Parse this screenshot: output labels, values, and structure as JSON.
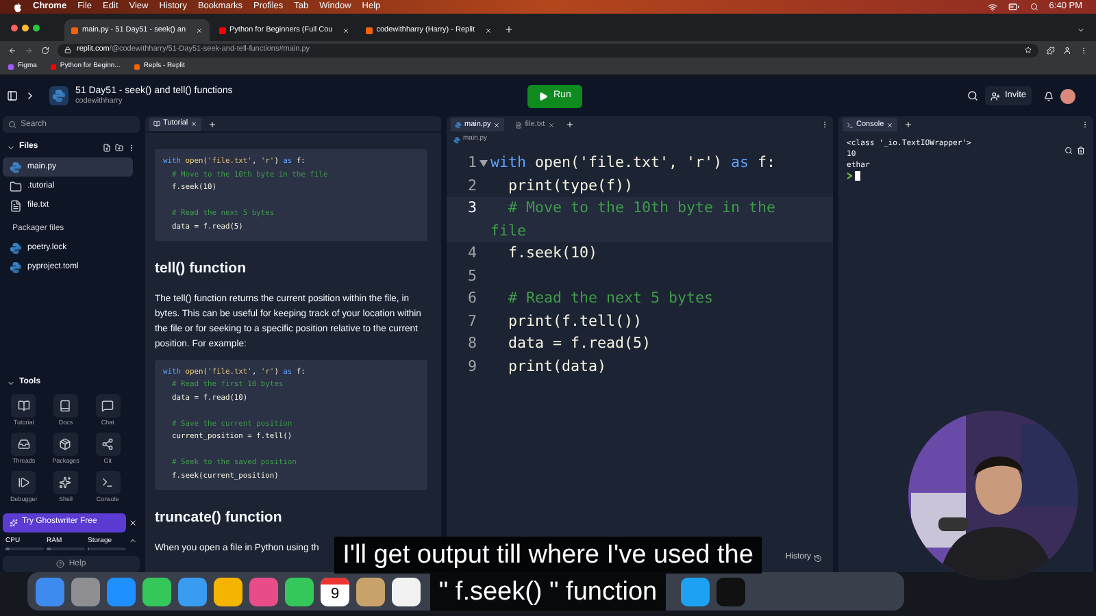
{
  "menu_bar": {
    "items": [
      "Chrome",
      "File",
      "Edit",
      "View",
      "History",
      "Bookmarks",
      "Profiles",
      "Tab",
      "Window",
      "Help"
    ],
    "clock": "6:40 PM"
  },
  "browser": {
    "tabs": [
      {
        "title": "main.py - 51 Day51 - seek() an",
        "selected": true
      },
      {
        "title": "Python for Beginners (Full Cou",
        "selected": false
      },
      {
        "title": "codewithharry (Harry) - Replit",
        "selected": false
      }
    ],
    "url_host": "replit.com",
    "url_path": "/@codewithharry/51-Day51-seek-and-tell-functions#main.py",
    "bookmarks": [
      "Figma",
      "Python for Beginn...",
      "Repls - Replit"
    ]
  },
  "header": {
    "title": "51 Day51 - seek() and tell() functions",
    "owner": "codewithharry",
    "run": "Run",
    "invite": "Invite"
  },
  "sidebar": {
    "search_placeholder": "Search",
    "files_heading": "Files",
    "files": [
      {
        "name": "main.py",
        "kind": "python",
        "selected": true
      },
      {
        "name": ".tutorial",
        "kind": "folder",
        "selected": false
      },
      {
        "name": "file.txt",
        "kind": "text",
        "selected": false
      }
    ],
    "packager_heading": "Packager files",
    "packager_files": [
      {
        "name": "poetry.lock",
        "kind": "python",
        "selected": false
      },
      {
        "name": "pyproject.toml",
        "kind": "python",
        "selected": false
      }
    ],
    "tools_heading": "Tools",
    "tools": [
      {
        "label": "Tutorial",
        "kind": "book"
      },
      {
        "label": "Docs",
        "kind": "docs"
      },
      {
        "label": "Chat",
        "kind": "chat"
      },
      {
        "label": "Threads",
        "kind": "inbox"
      },
      {
        "label": "Packages",
        "kind": "package"
      },
      {
        "label": "Git",
        "kind": "git"
      },
      {
        "label": "Debugger",
        "kind": "debug"
      },
      {
        "label": "Shell",
        "kind": "shell"
      },
      {
        "label": "Console",
        "kind": "console"
      }
    ],
    "ghostwriter": "Try Ghostwriter Free",
    "resources": [
      {
        "label": "CPU",
        "level": 0.1
      },
      {
        "label": "RAM",
        "level": 0.1
      },
      {
        "label": "Storage",
        "level": 0.05
      }
    ],
    "help": "Help"
  },
  "tutorial": {
    "tab": "Tutorial",
    "blocks": [
      {
        "kind": "code",
        "lines": [
          [
            {
              "kind": "kw",
              "text": "with"
            },
            {
              "kind": "fn",
              "text": " open("
            },
            {
              "kind": "str",
              "text": "'file.txt'"
            },
            {
              "kind": "plain",
              "text": ", "
            },
            {
              "kind": "str",
              "text": "'r'"
            },
            {
              "kind": "plain",
              "text": ") "
            },
            {
              "kind": "kw",
              "text": "as"
            },
            {
              "kind": "plain",
              "text": " f:"
            }
          ],
          [
            {
              "kind": "comment",
              "text": "  # Move to the 10th byte in the file"
            }
          ],
          [
            {
              "kind": "plain",
              "text": "  f.seek(10)"
            }
          ],
          [
            {
              "kind": "blank"
            }
          ],
          [
            {
              "kind": "comment",
              "text": "  # Read the next 5 bytes"
            }
          ],
          [
            {
              "kind": "plain",
              "text": "  data = f.read(5)"
            }
          ]
        ]
      },
      {
        "kind": "heading",
        "text": "tell() function"
      },
      {
        "kind": "paragraph",
        "text": "The tell() function returns the current position within the file, in bytes. This can be useful for keeping track of your location within the file or for seeking to a specific position relative to the current position. For example:"
      },
      {
        "kind": "code",
        "lines": [
          [
            {
              "kind": "kw",
              "text": "with"
            },
            {
              "kind": "fn",
              "text": " open("
            },
            {
              "kind": "str",
              "text": "'file.txt'"
            },
            {
              "kind": "plain",
              "text": ", "
            },
            {
              "kind": "str",
              "text": "'r'"
            },
            {
              "kind": "plain",
              "text": ") "
            },
            {
              "kind": "kw",
              "text": "as"
            },
            {
              "kind": "plain",
              "text": " f:"
            }
          ],
          [
            {
              "kind": "comment",
              "text": "  # Read the first 10 bytes"
            }
          ],
          [
            {
              "kind": "plain",
              "text": "  data = f.read(10)"
            }
          ],
          [
            {
              "kind": "blank"
            }
          ],
          [
            {
              "kind": "comment",
              "text": "  # Save the current position"
            }
          ],
          [
            {
              "kind": "plain",
              "text": "  current_position = f.tell()"
            }
          ],
          [
            {
              "kind": "blank"
            }
          ],
          [
            {
              "kind": "comment",
              "text": "  # Seek to the saved position"
            }
          ],
          [
            {
              "kind": "plain",
              "text": "  f.seek(current_position)"
            }
          ]
        ]
      },
      {
        "kind": "heading",
        "text": "truncate() function"
      },
      {
        "kind": "paragraph",
        "text": "When you open a file in Python using th"
      }
    ]
  },
  "editor": {
    "tabs": [
      {
        "label": "main.py",
        "kind": "python",
        "selected": true
      },
      {
        "label": "file.txt",
        "kind": "text",
        "selected": false
      }
    ],
    "breadcrumb": "main.py",
    "lines": [
      {
        "number": "1",
        "selected": false,
        "segments": [
          {
            "kind": "kw",
            "text": "with"
          },
          {
            "kind": "plain",
            "text": " open('file.txt', 'r') "
          },
          {
            "kind": "kw",
            "text": "as"
          },
          {
            "kind": "plain",
            "text": " f:"
          }
        ]
      },
      {
        "number": "2",
        "selected": false,
        "segments": [
          {
            "kind": "plain",
            "text": "  print(type(f))"
          }
        ]
      },
      {
        "number": "3",
        "selected": true,
        "segments": [
          {
            "kind": "comment",
            "text": "  # Move to the 10th byte in the file"
          }
        ]
      },
      {
        "number": "4",
        "selected": false,
        "segments": [
          {
            "kind": "plain",
            "text": "  f.seek(10)"
          }
        ]
      },
      {
        "number": "5",
        "selected": false
      },
      {
        "number": "6",
        "selected": false,
        "segments": [
          {
            "kind": "comment",
            "text": "  # Read the next 5 bytes"
          }
        ]
      },
      {
        "number": "7",
        "selected": false,
        "segments": [
          {
            "kind": "plain",
            "text": "  print(f.tell())"
          }
        ]
      },
      {
        "number": "8",
        "selected": false,
        "segments": [
          {
            "kind": "plain",
            "text": "  data = f.read(5)"
          }
        ]
      },
      {
        "number": "9",
        "selected": false,
        "segments": [
          {
            "kind": "plain",
            "text": "  print(data)"
          }
        ]
      }
    ],
    "history": "History"
  },
  "console": {
    "tab": "Console",
    "lines": [
      "<class '_io.TextIOWrapper'>",
      "10",
      "ethar"
    ]
  },
  "dock": {
    "calendar_day": "9"
  },
  "subtitles": [
    "I'll get output till where I've used the",
    "\" f.seek() \" function"
  ]
}
